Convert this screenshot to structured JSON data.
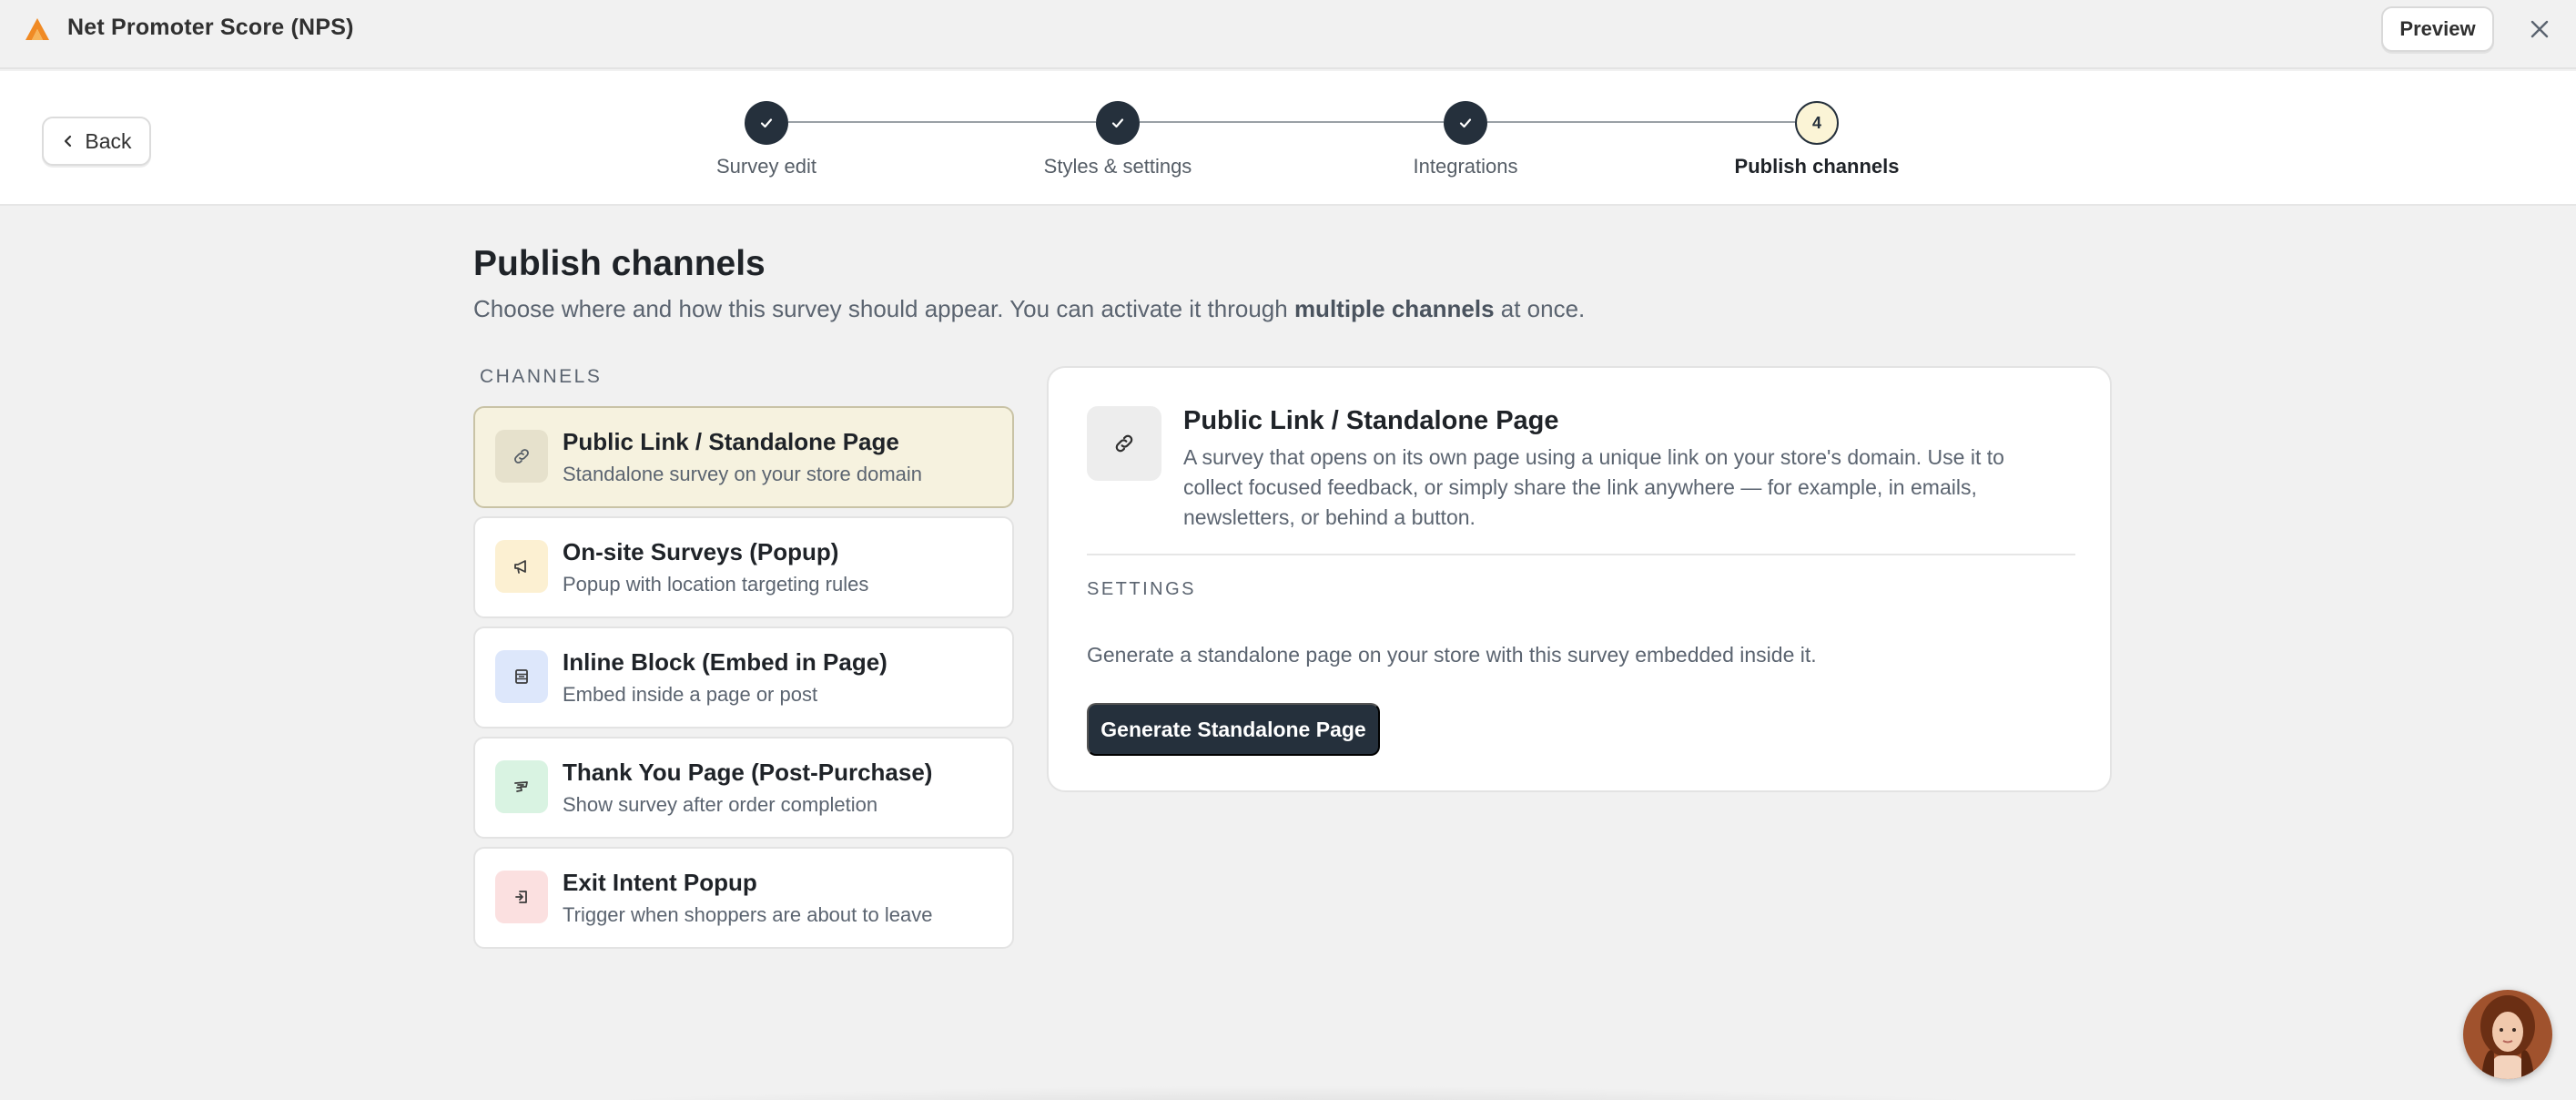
{
  "app": {
    "title": "Net Promoter Score (NPS)",
    "preview_label": "Preview"
  },
  "stepper": {
    "back_label": "Back",
    "steps": [
      {
        "label": "Survey edit",
        "state": "done"
      },
      {
        "label": "Styles & settings",
        "state": "done"
      },
      {
        "label": "Integrations",
        "state": "done"
      },
      {
        "label": "Publish channels",
        "state": "current",
        "number": "4"
      }
    ]
  },
  "page": {
    "title": "Publish channels",
    "subtitle_before": "Choose where and how this survey should appear. You can activate it through ",
    "subtitle_bold": "multiple channels",
    "subtitle_after": " at once."
  },
  "channels": {
    "section_label": "CHANNELS",
    "items": [
      {
        "title": "Public Link / Standalone Page",
        "desc": "Standalone survey on your store domain",
        "icon": "link-icon",
        "icon_bg": "#e6e1cc",
        "selected": true
      },
      {
        "title": "On-site Surveys (Popup)",
        "desc": "Popup with location targeting rules",
        "icon": "megaphone-icon",
        "icon_bg": "#fcf0d2",
        "selected": false
      },
      {
        "title": "Inline Block (Embed in Page)",
        "desc": "Embed inside a page or post",
        "icon": "embed-block-icon",
        "icon_bg": "#dde7fb",
        "selected": false
      },
      {
        "title": "Thank You Page (Post-Purchase)",
        "desc": "Show survey after order completion",
        "icon": "receipt-icon",
        "icon_bg": "#d9f3e2",
        "selected": false
      },
      {
        "title": "Exit Intent Popup",
        "desc": "Trigger when shoppers are about to leave",
        "icon": "exit-icon",
        "icon_bg": "#fbe0e0",
        "selected": false
      }
    ]
  },
  "detail": {
    "title": "Public Link / Standalone Page",
    "description": "A survey that opens on its own page using a unique link on your store's domain. Use it to collect focused feedback, or simply share the link anywhere — for example, in emails, newsletters, or behind a button.",
    "settings_label": "SETTINGS",
    "settings_text": "Generate a standalone page on your store with this survey embedded inside it.",
    "button_label": "Generate Standalone Page"
  },
  "colors": {
    "accent_dark": "#25303c",
    "selected_bg": "#f6f2df",
    "logo_orange": "#f08a24"
  }
}
